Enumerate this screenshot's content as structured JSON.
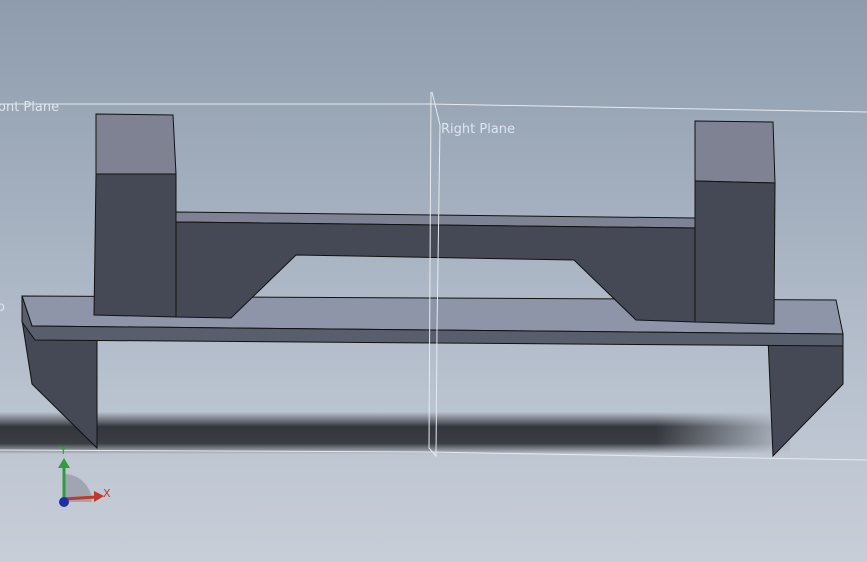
{
  "viewport": {
    "planes": {
      "front_plane_label": "ont Plane",
      "right_plane_label": "Right Plane",
      "top_plane_label": "o"
    },
    "triad": {
      "x_label": "X",
      "y_label": "Y",
      "x_color": "#c0392b",
      "y_color": "#2e9e3a",
      "z_color": "#1f2fa8"
    },
    "colors": {
      "part_light_face": "#7f8293",
      "part_dark_face": "#454955",
      "part_plate_face": "#8e95a8",
      "shadow": "#2c2e33"
    }
  }
}
